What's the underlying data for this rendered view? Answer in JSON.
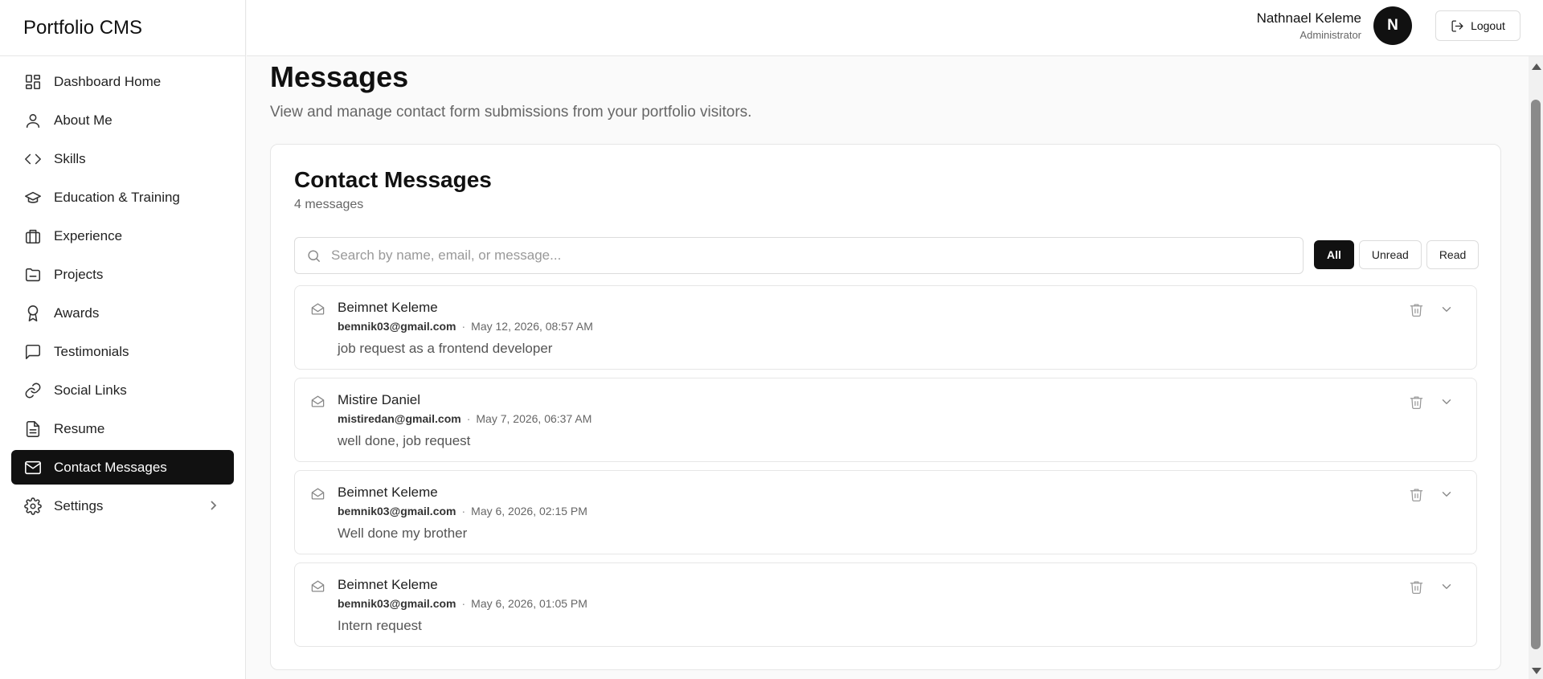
{
  "brand": "Portfolio CMS",
  "sidebar": {
    "items": [
      {
        "label": "Dashboard Home",
        "icon": "dashboard-icon"
      },
      {
        "label": "About Me",
        "icon": "user-icon"
      },
      {
        "label": "Skills",
        "icon": "code-icon"
      },
      {
        "label": "Education & Training",
        "icon": "graduation-cap-icon"
      },
      {
        "label": "Experience",
        "icon": "briefcase-icon"
      },
      {
        "label": "Projects",
        "icon": "folder-icon"
      },
      {
        "label": "Awards",
        "icon": "award-icon"
      },
      {
        "label": "Testimonials",
        "icon": "message-square-icon"
      },
      {
        "label": "Social Links",
        "icon": "link-icon"
      },
      {
        "label": "Resume",
        "icon": "file-text-icon"
      },
      {
        "label": "Contact Messages",
        "icon": "mail-icon",
        "active": true
      },
      {
        "label": "Settings",
        "icon": "gear-icon"
      }
    ]
  },
  "header": {
    "user_name": "Nathnael Keleme",
    "user_role": "Administrator",
    "avatar_initial": "N",
    "logout_label": "Logout"
  },
  "page": {
    "title": "Messages",
    "subtitle": "View and manage contact form submissions from your portfolio visitors."
  },
  "card": {
    "title": "Contact Messages",
    "count": "4 messages",
    "search_placeholder": "Search by name, email, or message...",
    "filters": [
      "All",
      "Unread",
      "Read"
    ],
    "active_filter": "All"
  },
  "messages": [
    {
      "name": "Beimnet Keleme",
      "email": "bemnik03@gmail.com",
      "date": "May 12, 2026, 08:57 AM",
      "body": "job request as a frontend developer"
    },
    {
      "name": "Mistire Daniel",
      "email": "mistiredan@gmail.com",
      "date": "May 7, 2026, 06:37 AM",
      "body": "well done, job request"
    },
    {
      "name": "Beimnet Keleme",
      "email": "bemnik03@gmail.com",
      "date": "May 6, 2026, 02:15 PM",
      "body": "Well done my brother"
    },
    {
      "name": "Beimnet Keleme",
      "email": "bemnik03@gmail.com",
      "date": "May 6, 2026, 01:05 PM",
      "body": "Intern request"
    }
  ],
  "colors": {
    "accent": "#111111",
    "border": "#e6e6e6",
    "muted": "#666666"
  }
}
